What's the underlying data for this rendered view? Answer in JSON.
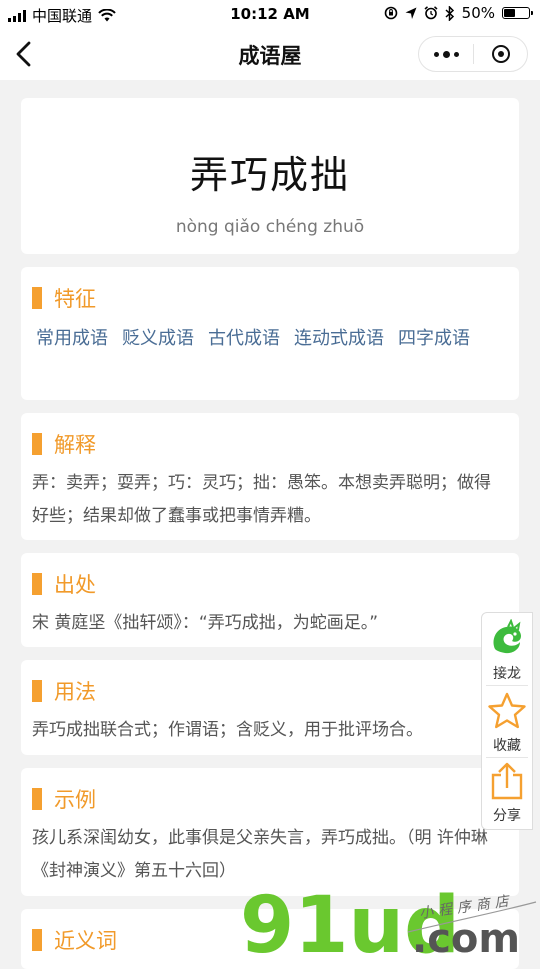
{
  "status_bar": {
    "carrier": "中国联通",
    "time": "10:12 AM",
    "battery": "50%",
    "battery_level": 0.5
  },
  "nav": {
    "title": "成语屋"
  },
  "idiom": {
    "text": "弄巧成拙",
    "pinyin": "nòng qiǎo chéng zhuō"
  },
  "sections": {
    "features": {
      "title": "特征",
      "tags": [
        "常用成语",
        "贬义成语",
        "古代成语",
        "连动式成语",
        "四字成语"
      ]
    },
    "explanation": {
      "title": "解释",
      "text": "弄：卖弄；耍弄；巧：灵巧；拙：愚笨。本想卖弄聪明；做得好些；结果却做了蠢事或把事情弄糟。"
    },
    "source": {
      "title": "出处",
      "text": "宋 黄庭坚《拙轩颂》：“弄巧成拙，为蛇画足。”"
    },
    "usage": {
      "title": "用法",
      "text": "弄巧成拙联合式；作谓语；含贬义，用于批评场合。"
    },
    "example": {
      "title": "示例",
      "text": "孩儿系深闺幼女，此事俱是父亲失言，弄巧成拙。（明 许仲琳《封神演义》第五十六回）"
    },
    "synonyms": {
      "title": "近义词"
    }
  },
  "side_actions": {
    "solitaire": "接龙",
    "favorite": "收藏",
    "share": "分享"
  },
  "watermark": {
    "brand": "91ud",
    "domain": ".com",
    "tagline": "小程序商店"
  },
  "colors": {
    "accent": "#f5a030",
    "tag_link": "#4a6d95",
    "dragon_green": "#3dbb3d",
    "watermark_green": "#6ac82f"
  }
}
